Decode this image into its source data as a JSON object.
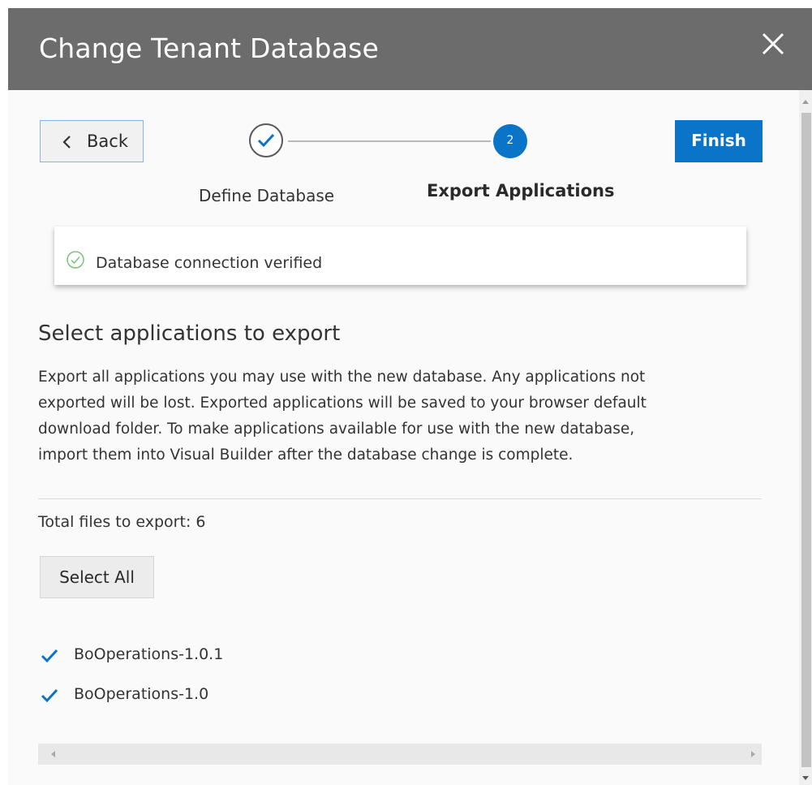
{
  "dialog": {
    "title": "Change Tenant Database",
    "close_icon": "close-icon"
  },
  "toolbar": {
    "back_label": "Back",
    "back_icon": "chevron-left-icon",
    "finish_label": "Finish"
  },
  "train": {
    "steps": [
      {
        "label": "Define Database",
        "state": "completed",
        "icon": "checkmark-icon"
      },
      {
        "label": "Export Applications",
        "state": "current",
        "number": "2"
      }
    ]
  },
  "status": {
    "message": "Database connection verified",
    "icon": "check-circle-icon"
  },
  "main": {
    "section_title": "Select applications to export",
    "description": "Export all applications you may use with the new database. Any applications not exported will be lost. Exported applications will be saved to your browser default download folder. To make applications available for use with the new database, import them into Visual Builder after the database change is complete.",
    "total_label": "Total files to export: 6",
    "select_all_label": "Select All",
    "applications": [
      {
        "name": "BoOperations-1.0.1",
        "checked": true
      },
      {
        "name": "BoOperations-1.0",
        "checked": true
      }
    ]
  },
  "colors": {
    "header_bg": "#6c6c6c",
    "accent": "#0a74c9"
  }
}
